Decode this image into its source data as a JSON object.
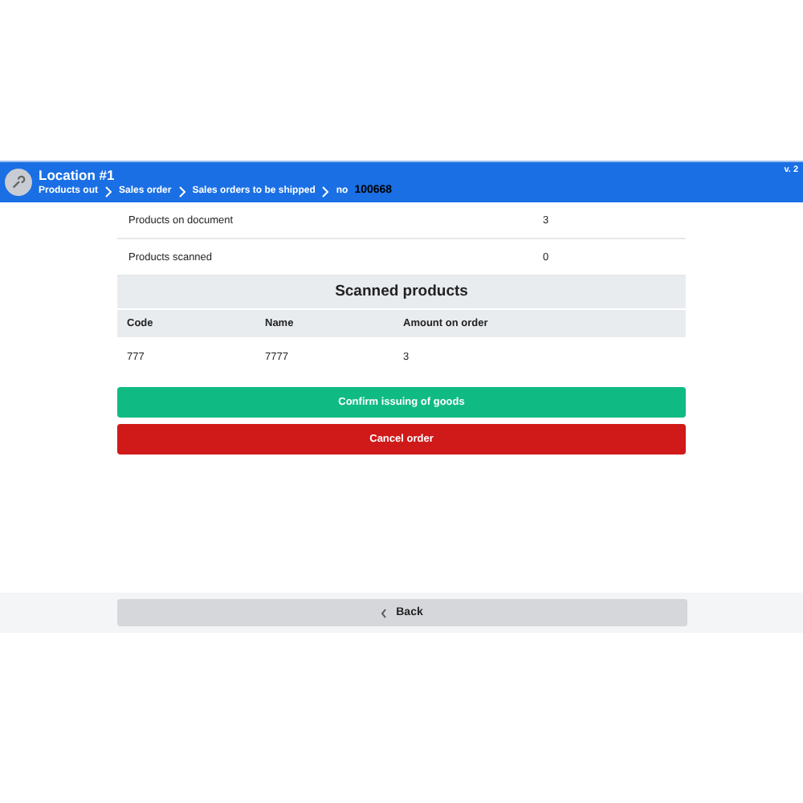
{
  "header": {
    "title": "Location #1",
    "version": "v. 2",
    "breadcrumbs": [
      "Products out",
      "Sales order",
      "Sales orders to be shipped"
    ],
    "document_prefix": "no",
    "document_number": "100668"
  },
  "summary": [
    {
      "label": "Products on document",
      "value": "3"
    },
    {
      "label": "Products scanned",
      "value": "0"
    }
  ],
  "table": {
    "title": "Scanned products",
    "columns": [
      "Code",
      "Name",
      "Amount on order"
    ],
    "rows": [
      [
        "777",
        "7777",
        "3"
      ]
    ]
  },
  "buttons": [
    {
      "label": "Confirm issuing of goods",
      "kind": "confirm"
    },
    {
      "label": "Cancel order",
      "kind": "cancel"
    }
  ],
  "footer": {
    "back_label": "Back"
  }
}
